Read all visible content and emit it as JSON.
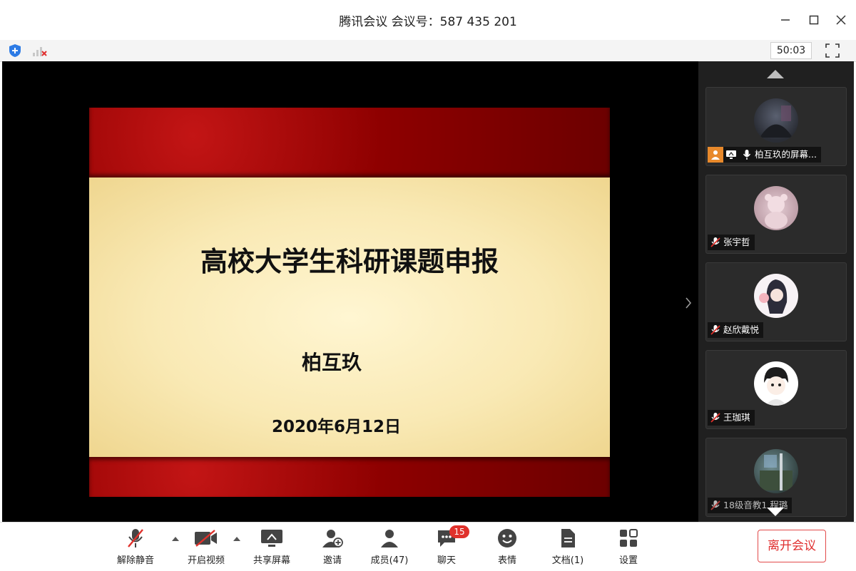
{
  "window": {
    "title": "腾讯会议 会议号：587 435 201"
  },
  "infobar": {
    "timer": "50:03"
  },
  "slide": {
    "title": "高校大学生科研课题申报",
    "author": "柏互玖",
    "date": "2020年6月12日"
  },
  "participants": [
    {
      "name": "柏互玖的屏幕...",
      "role": "host-sharing"
    },
    {
      "name": "张宇哲",
      "role": "muted"
    },
    {
      "name": "赵欣戴悦",
      "role": "muted"
    },
    {
      "name": "王珈琪",
      "role": "muted"
    },
    {
      "name": "18级音教1 程璐",
      "role": "muted"
    }
  ],
  "toolbar": {
    "unmute": "解除静音",
    "video": "开启视频",
    "share": "共享屏幕",
    "invite": "邀请",
    "members": "成员(47)",
    "chat": "聊天",
    "chat_badge": "15",
    "emoji": "表情",
    "docs": "文档(1)",
    "settings": "设置",
    "leave": "离开会议"
  },
  "colors": {
    "leave_red": "#e02f2f",
    "badge_red": "#e0312b",
    "host_orange": "#e8892b"
  }
}
